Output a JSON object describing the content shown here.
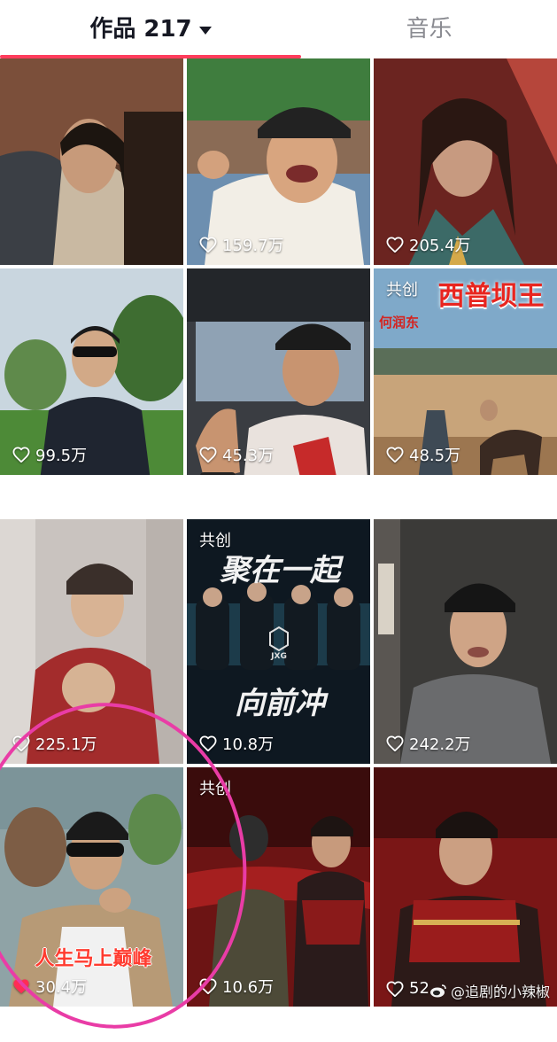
{
  "tabs": {
    "works_label": "作品 217",
    "music_label": "音乐"
  },
  "colors": {
    "accent": "#ff3d5c",
    "circle": "#e93ca6",
    "liked_heart": "#ff2c55"
  },
  "tiles": [
    {
      "likes": "",
      "badge": ""
    },
    {
      "likes": "159.7万",
      "badge": ""
    },
    {
      "likes": "205.4万",
      "badge": ""
    },
    {
      "likes": "99.5万",
      "badge": ""
    },
    {
      "likes": "45.3万",
      "badge": ""
    },
    {
      "likes": "48.5万",
      "badge": "共创",
      "title": "西普坝王",
      "subtitle": "何润东"
    },
    {
      "likes": "225.1万",
      "badge": ""
    },
    {
      "likes": "10.8万",
      "badge": "共创",
      "title": "聚在一起",
      "title2": "向前冲",
      "logo": "JXG"
    },
    {
      "likes": "242.2万",
      "badge": ""
    },
    {
      "likes": "30.4万",
      "badge": "",
      "title": "人生马上巅峰",
      "liked": true
    },
    {
      "likes": "10.6万",
      "badge": "共创"
    },
    {
      "likes": "52",
      "badge": ""
    }
  ],
  "watermark": "@追剧的小辣椒"
}
